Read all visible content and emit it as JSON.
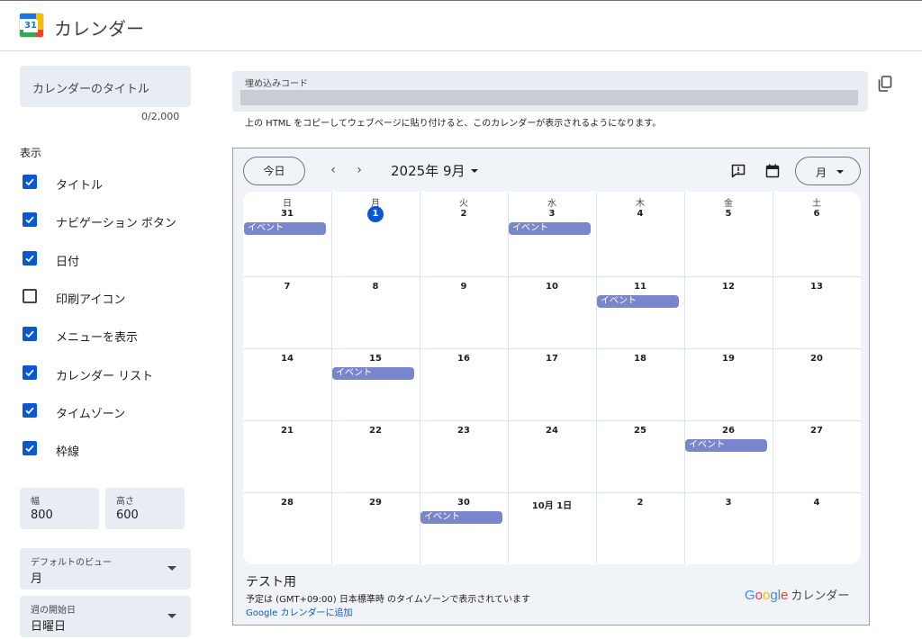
{
  "app": {
    "title": "カレンダー",
    "logo_number": "31"
  },
  "settings": {
    "title_field": {
      "placeholder": "カレンダーのタイトル",
      "counter": "0/2,000"
    },
    "display_label": "表示",
    "options": [
      {
        "label": "タイトル",
        "checked": true
      },
      {
        "label": "ナビゲーション ボタン",
        "checked": true
      },
      {
        "label": "日付",
        "checked": true
      },
      {
        "label": "印刷アイコン",
        "checked": false
      },
      {
        "label": "メニューを表示",
        "checked": true
      },
      {
        "label": "カレンダー リスト",
        "checked": true
      },
      {
        "label": "タイムゾーン",
        "checked": true
      },
      {
        "label": "枠線",
        "checked": true
      }
    ],
    "width": {
      "label": "幅",
      "value": "800"
    },
    "height": {
      "label": "高さ",
      "value": "600"
    },
    "default_view": {
      "label": "デフォルトのビュー",
      "value": "月"
    },
    "week_start": {
      "label": "週の開始日",
      "value": "日曜日"
    }
  },
  "embed": {
    "label": "埋め込みコード",
    "hint": "上の HTML をコピーしてウェブページに貼り付けると、このカレンダーが表示されるようになります。"
  },
  "calendar": {
    "today_label": "今日",
    "prev_icon": "‹",
    "next_icon": "›",
    "month_label": "2025年 9月",
    "view_label": "月",
    "weekdays": [
      "日",
      "月",
      "火",
      "水",
      "木",
      "金",
      "土"
    ],
    "weeks": [
      [
        "31",
        "1",
        "2",
        "3",
        "4",
        "5",
        "6"
      ],
      [
        "7",
        "8",
        "9",
        "10",
        "11",
        "12",
        "13"
      ],
      [
        "14",
        "15",
        "16",
        "17",
        "18",
        "19",
        "20"
      ],
      [
        "21",
        "22",
        "23",
        "24",
        "25",
        "26",
        "27"
      ],
      [
        "28",
        "29",
        "30",
        "10月 1日",
        "2",
        "3",
        "4"
      ]
    ],
    "today": {
      "week": 0,
      "day": 1
    },
    "events": [
      {
        "week": 0,
        "day": 0,
        "title": "イベント"
      },
      {
        "week": 0,
        "day": 3,
        "title": "イベント"
      },
      {
        "week": 1,
        "day": 4,
        "title": "イベント"
      },
      {
        "week": 2,
        "day": 1,
        "title": "イベント"
      },
      {
        "week": 3,
        "day": 5,
        "title": "イベント"
      },
      {
        "week": 4,
        "day": 2,
        "title": "イベント"
      }
    ],
    "footer": {
      "title": "テスト用",
      "timezone_note": "予定は (GMT+09:00) 日本標準時 のタイムゾーンで表示されています",
      "add_link": "Google カレンダーに追加",
      "brand_google": "Google",
      "brand_product": "カレンダー"
    }
  },
  "colors": {
    "accent": "#0b57d0",
    "event": "#7986cb",
    "panel": "#e8edf4",
    "calendar_bg": "#f0f4f9"
  }
}
